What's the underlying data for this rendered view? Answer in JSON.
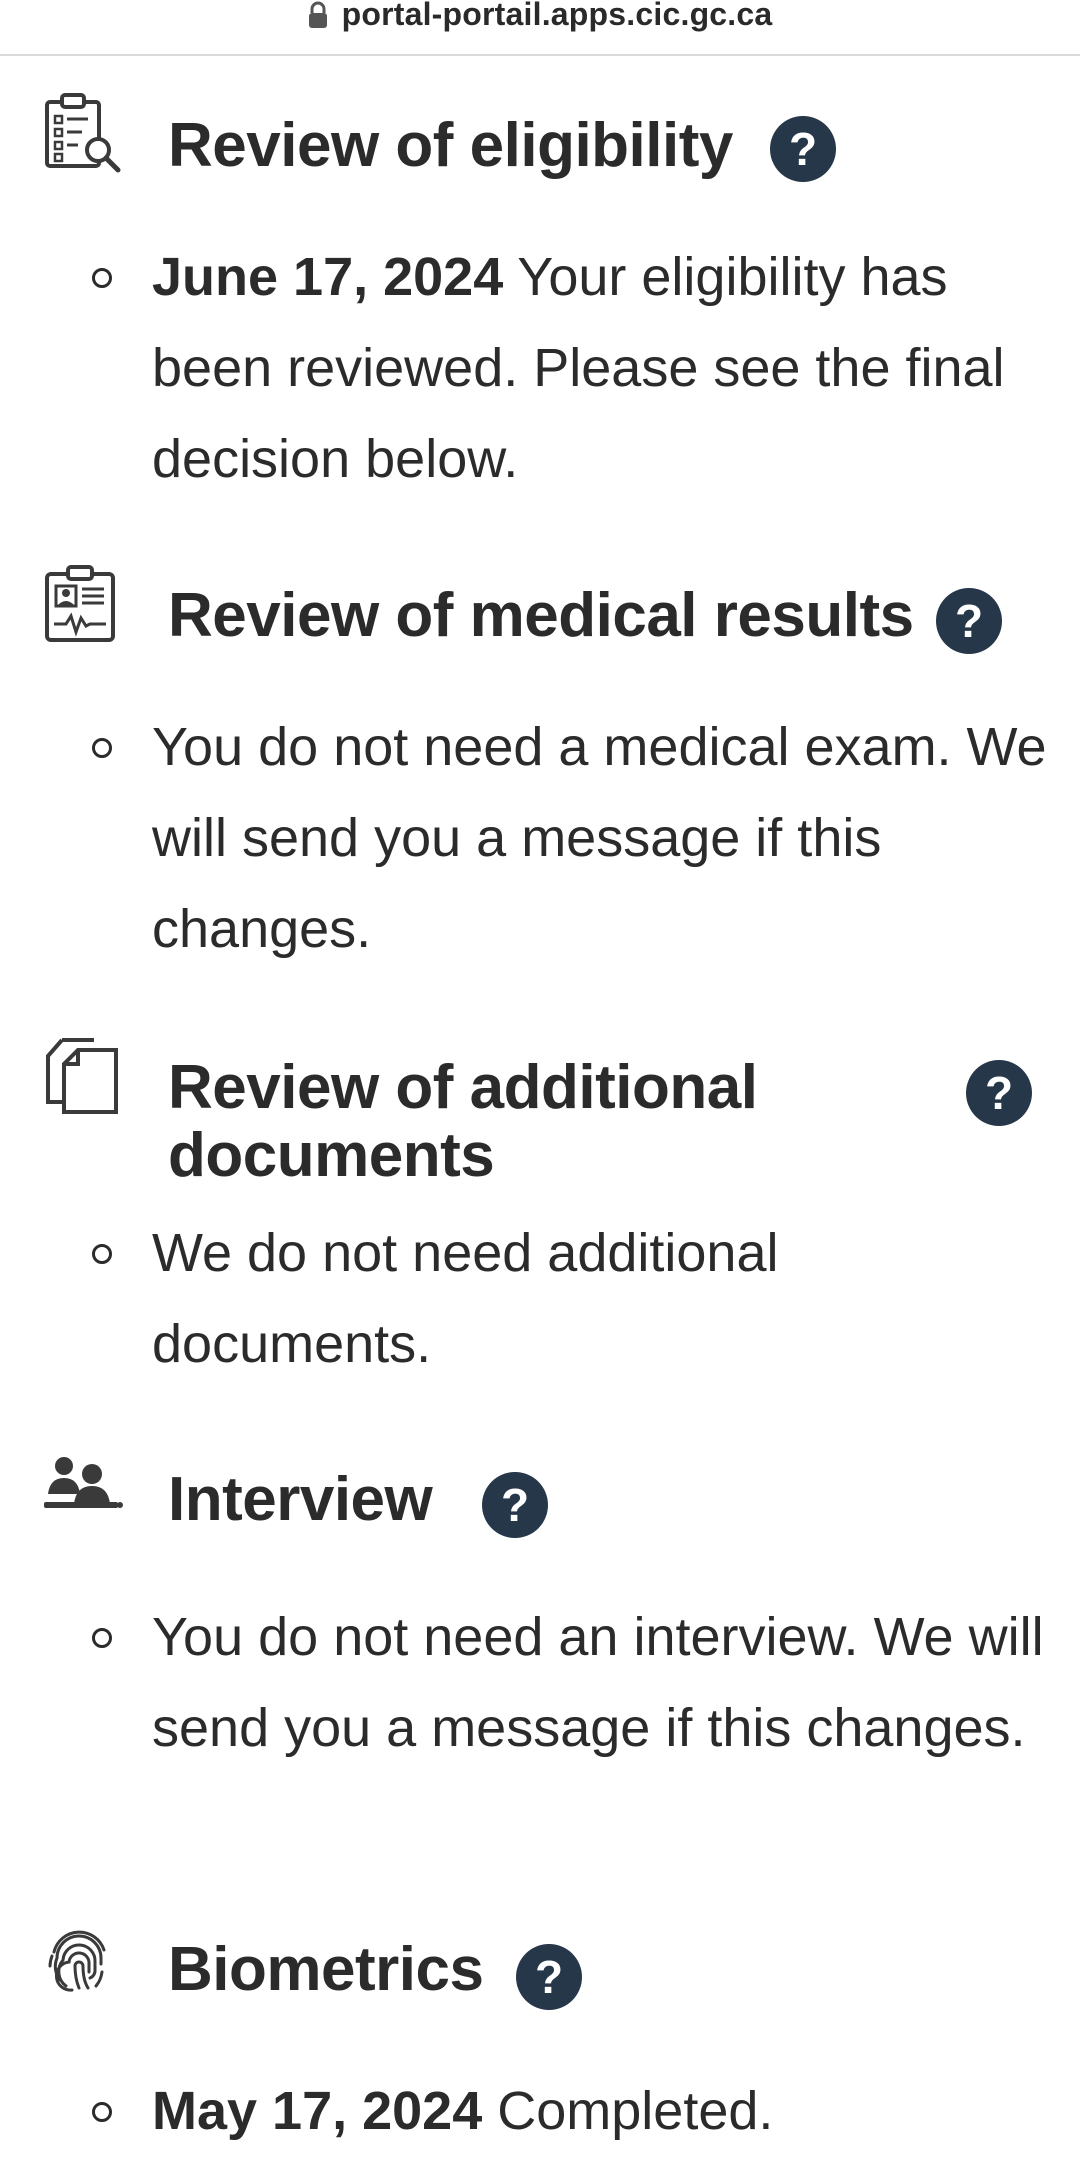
{
  "browser": {
    "url": "portal-portail.apps.cic.gc.ca",
    "lock_icon": "lock-icon"
  },
  "theme": {
    "help_button_color": "#26374a",
    "text_color": "#2b2b2b"
  },
  "sections": [
    {
      "icon": "clipboard-search-icon",
      "title": "Review of eligibility",
      "help_label": "?",
      "date": "June 17, 2024",
      "text": "Your eligibility has been reviewed. Please see the final decision below."
    },
    {
      "icon": "medical-record-icon",
      "title": "Review of medical results",
      "help_label": "?",
      "date": "",
      "text": "You do not need a medical exam. We will send you a message if this changes."
    },
    {
      "icon": "documents-icon",
      "title": "Review of additional documents",
      "help_label": "?",
      "date": "",
      "text": "We do not need additional documents."
    },
    {
      "icon": "people-icon",
      "title": "Interview",
      "help_label": "?",
      "date": "",
      "text": "You do not need an interview. We will send you a message if this changes."
    },
    {
      "icon": "fingerprint-icon",
      "title": "Biometrics",
      "help_label": "?",
      "date": "May 17, 2024",
      "text": "Completed."
    }
  ]
}
